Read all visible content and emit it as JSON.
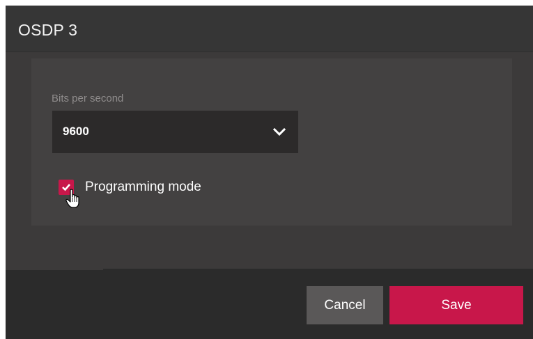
{
  "dialog": {
    "title": "OSDP 3"
  },
  "form": {
    "bits_per_second": {
      "label": "Bits per second",
      "value": "9600",
      "icon": "chevron-down-icon"
    },
    "programming_mode": {
      "label": "Programming mode",
      "checked": true,
      "icon": "checkmark-icon"
    }
  },
  "footer": {
    "cancel_label": "Cancel",
    "save_label": "Save"
  },
  "colors": {
    "accent": "#c8174a",
    "dialog_background": "#2b2b2b",
    "panel_background": "#434141",
    "cancel_button": "#5a5858"
  }
}
